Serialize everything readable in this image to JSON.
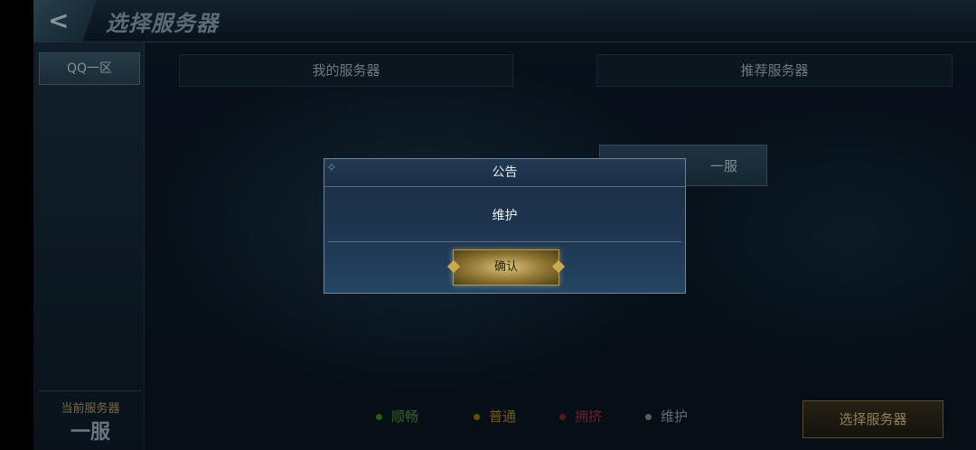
{
  "header": {
    "title": "选择服务器",
    "back_icon": "back-arrow-icon"
  },
  "sidebar": {
    "zone_tab": "QQ一区",
    "current_label": "当前服务器",
    "current_server": "一服"
  },
  "columns": {
    "my_servers": "我的服务器",
    "recommended": "推荐服务器"
  },
  "server_card": {
    "name": "一服"
  },
  "legend": [
    {
      "label": "顺畅",
      "color": "#3f8f1e"
    },
    {
      "label": "普通",
      "color": "#9b7219"
    },
    {
      "label": "拥挤",
      "color": "#8f2222"
    },
    {
      "label": "维护",
      "color": "#8b8f92"
    }
  ],
  "select_button": "选择服务器",
  "dialog": {
    "title": "公告",
    "message": "维护",
    "confirm": "确认"
  }
}
